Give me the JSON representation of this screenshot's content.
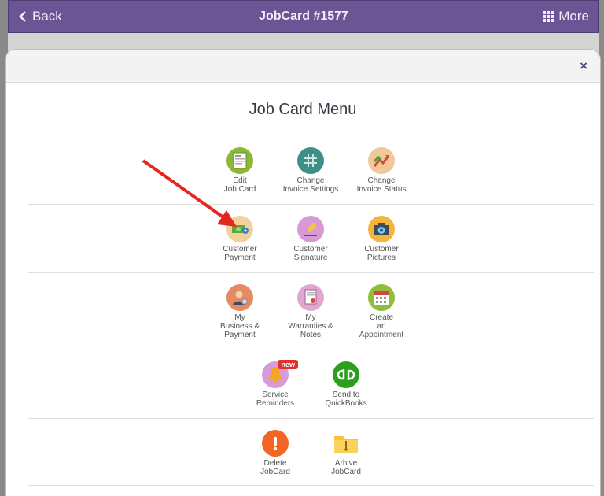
{
  "navbar": {
    "back_label": "Back",
    "title": "JobCard #1577",
    "more_label": "More"
  },
  "modal": {
    "title": "Job Card Menu",
    "close_label": "×",
    "rows": [
      [
        {
          "label": "Edit\nJob Card",
          "icon": "edit-document-icon"
        },
        {
          "label": "Change\nInvoice Settings",
          "icon": "hash-grid-icon"
        },
        {
          "label": "Change\nInvoice Status",
          "icon": "status-arrows-icon"
        }
      ],
      [
        {
          "label": "Customer\nPayment",
          "icon": "payment-cash-icon"
        },
        {
          "label": "Customer\nSignature",
          "icon": "signature-pen-icon"
        },
        {
          "label": "Customer\nPictures",
          "icon": "camera-icon"
        }
      ],
      [
        {
          "label": "My\nBusiness &\nPayment",
          "icon": "business-person-icon"
        },
        {
          "label": "My\nWarranties &\nNotes",
          "icon": "warranty-certificate-icon"
        },
        {
          "label": "Create\nan\nAppointment",
          "icon": "calendar-icon"
        }
      ],
      [
        {
          "label": "Service\nReminders",
          "icon": "bell-icon",
          "badge": "new"
        },
        {
          "label": "Send to\nQuickBooks",
          "icon": "quickbooks-icon"
        }
      ],
      [
        {
          "label": "Delete\nJobCard",
          "icon": "exclamation-icon"
        },
        {
          "label": "Arhive\nJobCard",
          "icon": "archive-folder-icon"
        }
      ]
    ]
  },
  "colors": {
    "navbar": "#6b5594",
    "edit": "#8cb83a",
    "settings": "#3f8f89",
    "status": "#f0c89a",
    "payment": "#f2d29a",
    "signature": "#d89ad6",
    "pictures": "#f5b43a",
    "business": "#e58a63",
    "warranty": "#e1a8cf",
    "calendar": "#8fbf3a",
    "bell": "#d99bd8",
    "quickbooks": "#2ca01c",
    "delete": "#f26522",
    "archive": "#f7c23a",
    "arrow": "#e5261f"
  }
}
